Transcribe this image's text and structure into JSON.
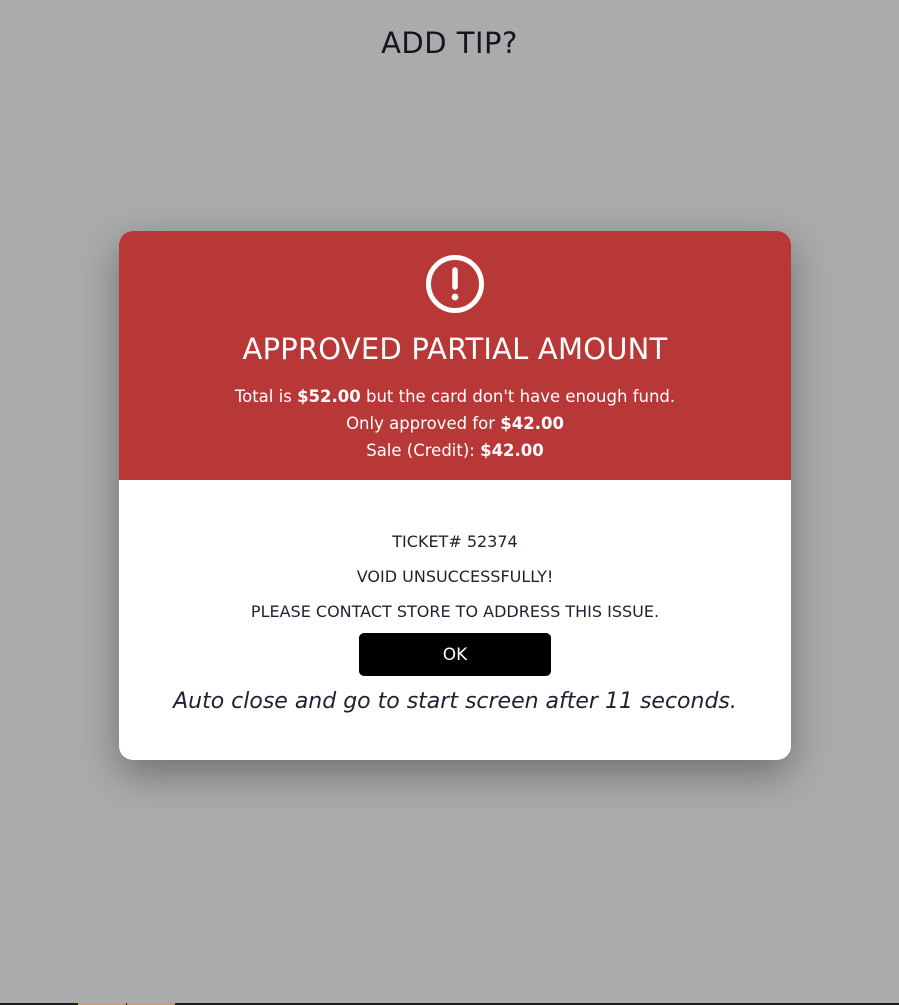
{
  "page": {
    "title": "ADD TIP?"
  },
  "modal": {
    "icon": "alert-circle-icon",
    "header_color": "#b83838",
    "title": "APPROVED PARTIAL AMOUNT",
    "total_prefix": "Total is",
    "total_amount": "$52.00",
    "total_suffix": "but the card don't have enough fund.",
    "approved_prefix": "Only approved for",
    "approved_amount": "$42.00",
    "sale_prefix": "Sale (Credit):",
    "sale_amount": "$42.00",
    "ticket": "TICKET# 52374",
    "void_status": "VOID UNSUCCESSFULLY!",
    "contact_message": "PLEASE CONTACT STORE TO ADDRESS THIS ISSUE.",
    "ok_label": "OK",
    "auto_close": "Auto close and go to start screen after 11 seconds."
  }
}
